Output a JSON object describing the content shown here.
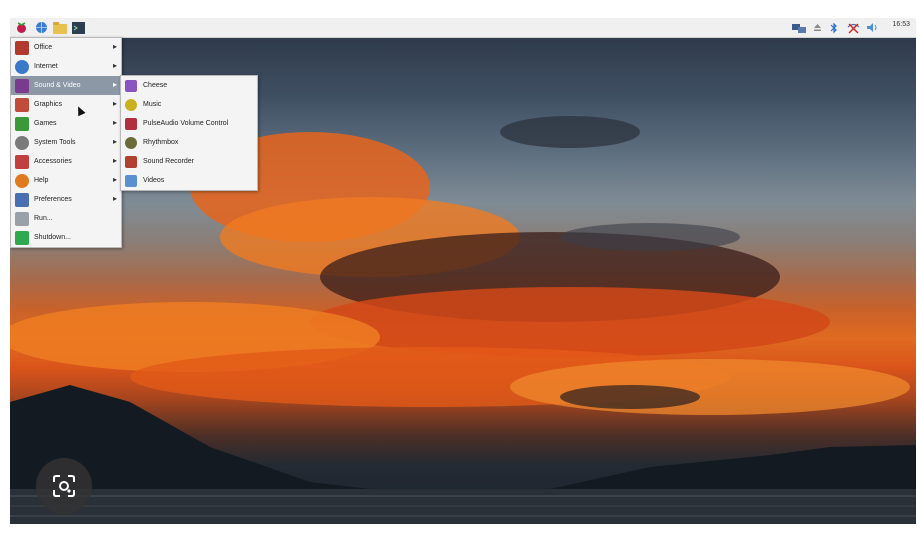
{
  "taskbar": {
    "clock": "16:53",
    "left_icons": [
      "raspberry-icon",
      "web-browser-icon",
      "file-manager-icon",
      "terminal-icon"
    ],
    "right_icons": [
      "network-icon",
      "eject-icon",
      "bluetooth-icon",
      "wifi-off-icon",
      "volume-icon"
    ]
  },
  "menu": {
    "items": [
      {
        "label": "Office",
        "icon": "office-icon",
        "color": "#b03a2e",
        "submenu": true
      },
      {
        "label": "Internet",
        "icon": "internet-icon",
        "color": "#3a78c9",
        "submenu": true
      },
      {
        "label": "Sound & Video",
        "icon": "sound-video-icon",
        "color": "#7a3b8f",
        "submenu": true,
        "selected": true
      },
      {
        "label": "Graphics",
        "icon": "graphics-icon",
        "color": "#c24c3a",
        "submenu": true
      },
      {
        "label": "Games",
        "icon": "games-icon",
        "color": "#3a9a3a",
        "submenu": true
      },
      {
        "label": "System Tools",
        "icon": "system-tools-icon",
        "color": "#7a7a7a",
        "submenu": true
      },
      {
        "label": "Accessories",
        "icon": "accessories-icon",
        "color": "#c04040",
        "submenu": true
      },
      {
        "label": "Help",
        "icon": "help-icon",
        "color": "#e07a20",
        "submenu": true
      },
      {
        "label": "Preferences",
        "icon": "preferences-icon",
        "color": "#4a6fb0",
        "submenu": true
      },
      {
        "label": "Run...",
        "icon": "run-icon",
        "color": "#9aa0a8",
        "submenu": false
      },
      {
        "label": "Shutdown...",
        "icon": "shutdown-icon",
        "color": "#2fa84f",
        "submenu": false
      }
    ]
  },
  "submenu": {
    "items": [
      {
        "label": "Cheese",
        "icon": "cheese-icon",
        "color": "#8a55c0"
      },
      {
        "label": "Music",
        "icon": "music-icon",
        "color": "#c8b020"
      },
      {
        "label": "PulseAudio Volume Control",
        "icon": "pulseaudio-icon",
        "color": "#b03040"
      },
      {
        "label": "Rhythmbox",
        "icon": "rhythmbox-icon",
        "color": "#6b6b3a"
      },
      {
        "label": "Sound Recorder",
        "icon": "sound-recorder-icon",
        "color": "#b04030"
      },
      {
        "label": "Videos",
        "icon": "videos-icon",
        "color": "#5a8fd0"
      }
    ]
  }
}
